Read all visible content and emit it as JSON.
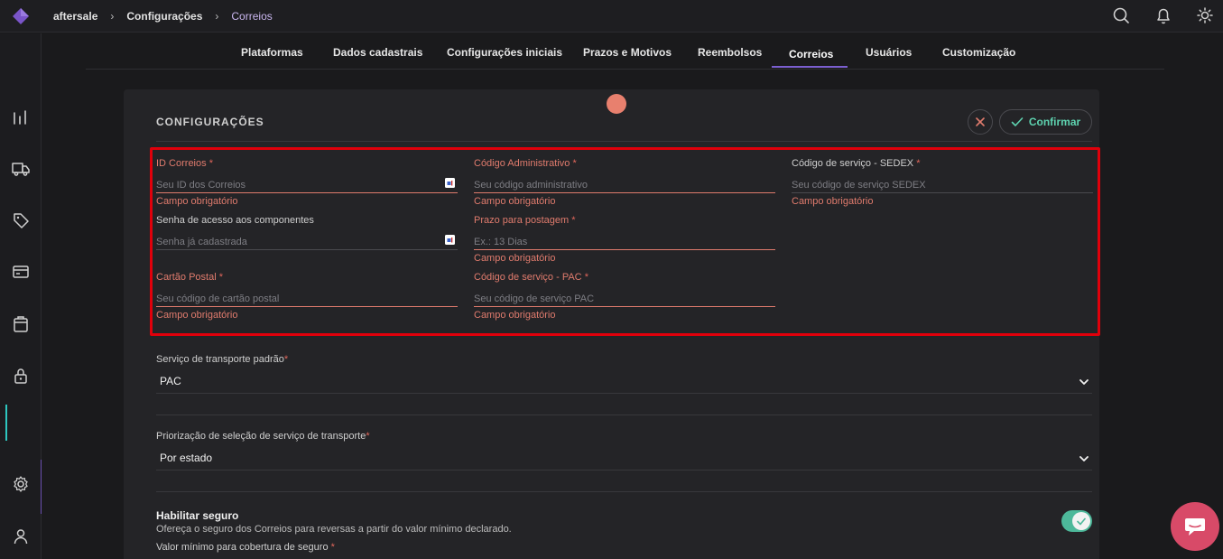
{
  "topbar": {
    "breadcrumb": [
      "aftersale",
      "Configurações",
      "Correios"
    ],
    "icons": [
      "search-icon",
      "bell-icon",
      "sun-icon"
    ]
  },
  "sidebar": {
    "icons": [
      "chart-icon",
      "truck-icon",
      "tag-icon",
      "card-icon",
      "box-icon",
      "lock-icon",
      "settings-icon",
      "user-icon"
    ]
  },
  "tabs": [
    "Plataformas",
    "Dados cadastrais",
    "Configurações iniciais",
    "Prazos e Motivos",
    "Reembolsos",
    "Correios",
    "Usuários",
    "Customização"
  ],
  "active_tab": "Correios",
  "panel": {
    "title": "CONFIGURAÇÕES",
    "confirm_label": "Confirmar"
  },
  "fields": {
    "id_correios": {
      "label": "ID Correios",
      "required": "*",
      "placeholder": "Seu ID dos Correios",
      "error": "Campo obrigatório"
    },
    "codigo_admin": {
      "label": "Código Administrativo",
      "required": "*",
      "placeholder": "Seu código administrativo",
      "error": "Campo obrigatório"
    },
    "codigo_sedex": {
      "label": "Código de serviço - SEDEX",
      "required": "*",
      "placeholder": "Seu código de serviço SEDEX",
      "error": "Campo obrigatório"
    },
    "senha": {
      "label": "Senha de acesso aos componentes",
      "placeholder": "Senha já cadastrada"
    },
    "prazo": {
      "label": "Prazo para postagem",
      "required": "*",
      "placeholder": "Ex.: 13 Dias",
      "error": "Campo obrigatório"
    },
    "cartao": {
      "label": "Cartão Postal",
      "required": "*",
      "placeholder": "Seu código de cartão postal",
      "error": "Campo obrigatório"
    },
    "codigo_pac": {
      "label": "Código de serviço - PAC",
      "required": "*",
      "placeholder": "Seu código de serviço PAC",
      "error": "Campo obrigatório"
    }
  },
  "transport": {
    "label": "Serviço de transporte padrão",
    "required": "*",
    "value": "PAC"
  },
  "priority": {
    "label": "Priorização de seleção de serviço de transporte",
    "required": "*",
    "value": "Por estado"
  },
  "insurance": {
    "title": "Habilitar seguro",
    "description": "Ofereça o seguro dos Correios para reversas a partir do valor mínimo declarado.",
    "min_label": "Valor mínimo para cobertura de seguro",
    "required": "*",
    "enabled": true
  },
  "colors": {
    "accent": "#7b5fd0",
    "error": "#e07b6d",
    "toggle_on": "#4db89a",
    "highlight_box": "#e0000b",
    "chat": "#d84a68"
  }
}
